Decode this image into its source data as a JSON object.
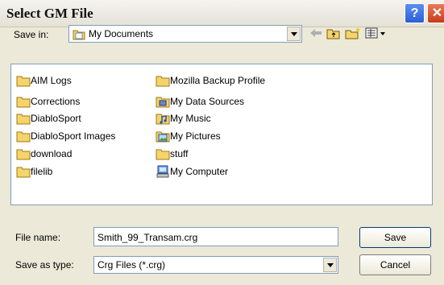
{
  "window": {
    "title": "Select GM File"
  },
  "save_in": {
    "label": "Save in:",
    "value": "My Documents"
  },
  "files": [
    {
      "name": "AIM Logs",
      "icon": "folder-icon"
    },
    {
      "name": "Corrections",
      "icon": "folder-icon"
    },
    {
      "name": "DiabloSport",
      "icon": "folder-icon"
    },
    {
      "name": "DiabloSport Images",
      "icon": "folder-icon"
    },
    {
      "name": "download",
      "icon": "folder-icon"
    },
    {
      "name": "filelib",
      "icon": "folder-icon"
    },
    {
      "name": "Mozilla Backup Profile",
      "icon": "folder-icon"
    },
    {
      "name": "My Data Sources",
      "icon": "data-sources-icon"
    },
    {
      "name": "My Music",
      "icon": "music-folder-icon"
    },
    {
      "name": "My Pictures",
      "icon": "pictures-folder-icon"
    },
    {
      "name": "stuff",
      "icon": "folder-icon"
    },
    {
      "name": "My Computer",
      "icon": "computer-icon"
    }
  ],
  "file_name": {
    "label": "File name:",
    "value": "Smith_99_Transam.crg"
  },
  "save_as_type": {
    "label": "Save as type:",
    "value": "Crg Files (*.crg)"
  },
  "buttons": {
    "save": "Save",
    "cancel": "Cancel"
  },
  "colors": {
    "titlebar": "#e4e2d6",
    "dialog": "#ece9d8",
    "help": "#2b5ed6",
    "close": "#c83b1a",
    "folder": "#f4d46b"
  }
}
